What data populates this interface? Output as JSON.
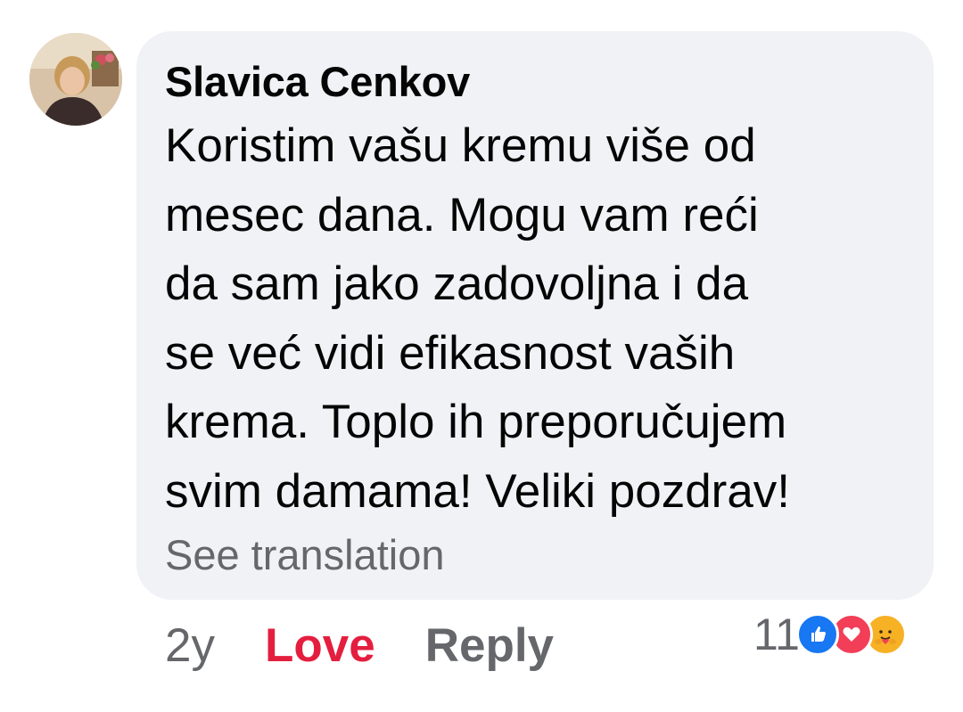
{
  "comment": {
    "author": "Slavica Cenkov",
    "text": "Koristim vašu kremu više od\nmesec dana. Mogu vam reći\nda sam jako zadovoljna i da\nse već vidi efikasnost vaših\nkrema. Toplo ih preporučujem\nsvim damama! Veliki pozdrav!",
    "see_translation": "See translation"
  },
  "actions": {
    "time": "2y",
    "love": "Love",
    "reply": "Reply"
  },
  "reactions": {
    "count": "11",
    "icons": [
      "like-icon",
      "heart-icon",
      "care-icon"
    ]
  },
  "colors": {
    "bubble": "#f0f2f5",
    "text": "#050505",
    "muted": "#65676b",
    "love": "#e41e3f",
    "like": "#1877f2",
    "heart": "#f33e58",
    "care": "#f7b125"
  }
}
